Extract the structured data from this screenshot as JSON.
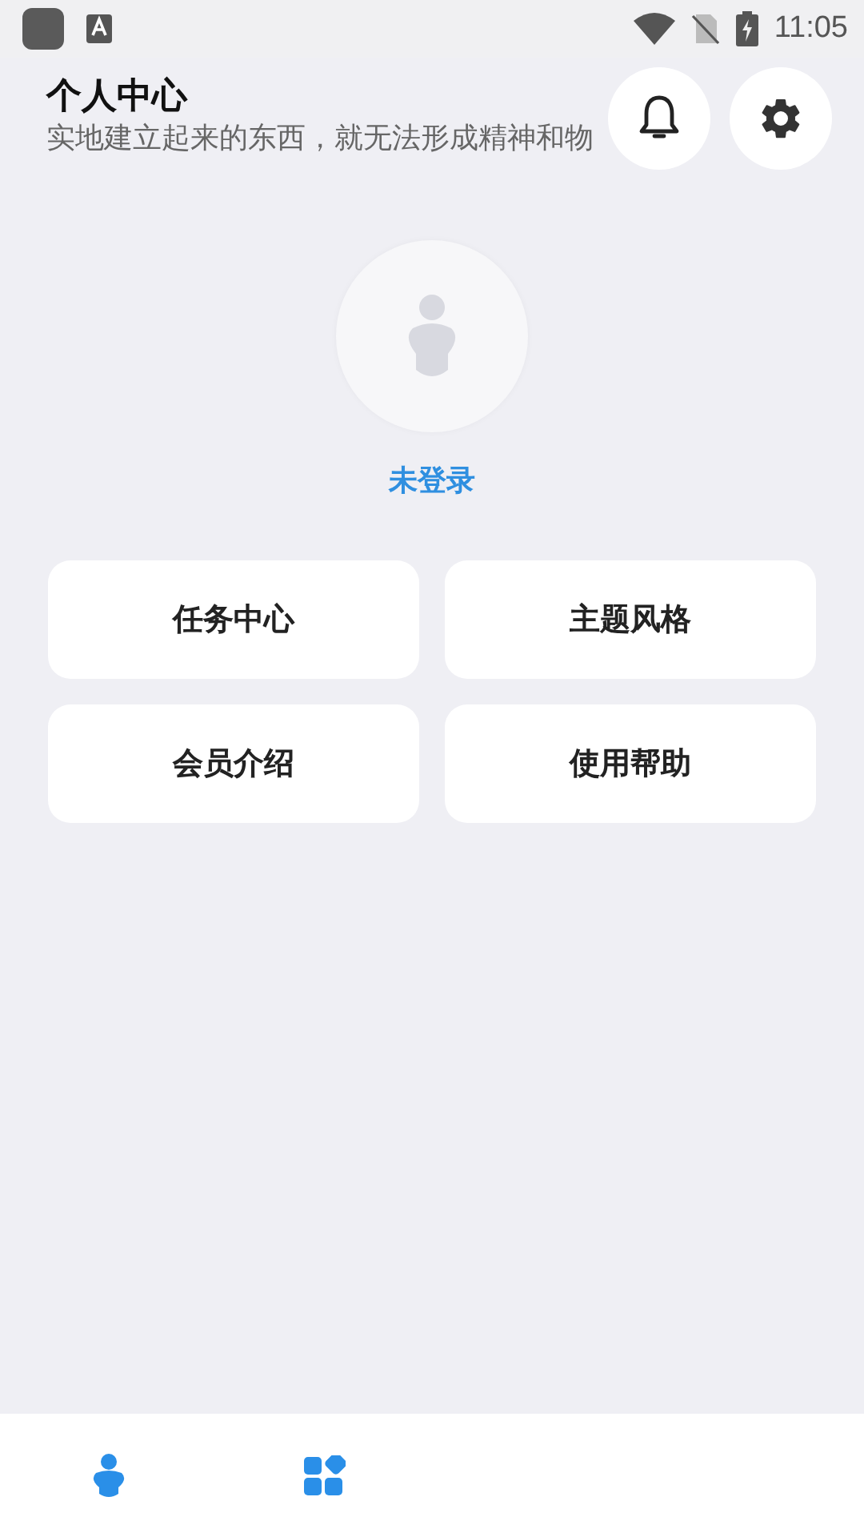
{
  "status_bar": {
    "time": "11:05"
  },
  "header": {
    "title": "个人中心",
    "subtitle": "实地建立起来的东西，就无法形成精神和物"
  },
  "profile": {
    "login_status": "未登录"
  },
  "menu": [
    {
      "label": "任务中心"
    },
    {
      "label": "主题风格"
    },
    {
      "label": "会员介绍"
    },
    {
      "label": "使用帮助"
    }
  ],
  "bottom_nav": [
    {
      "kind": "person"
    },
    {
      "kind": "apps"
    }
  ]
}
